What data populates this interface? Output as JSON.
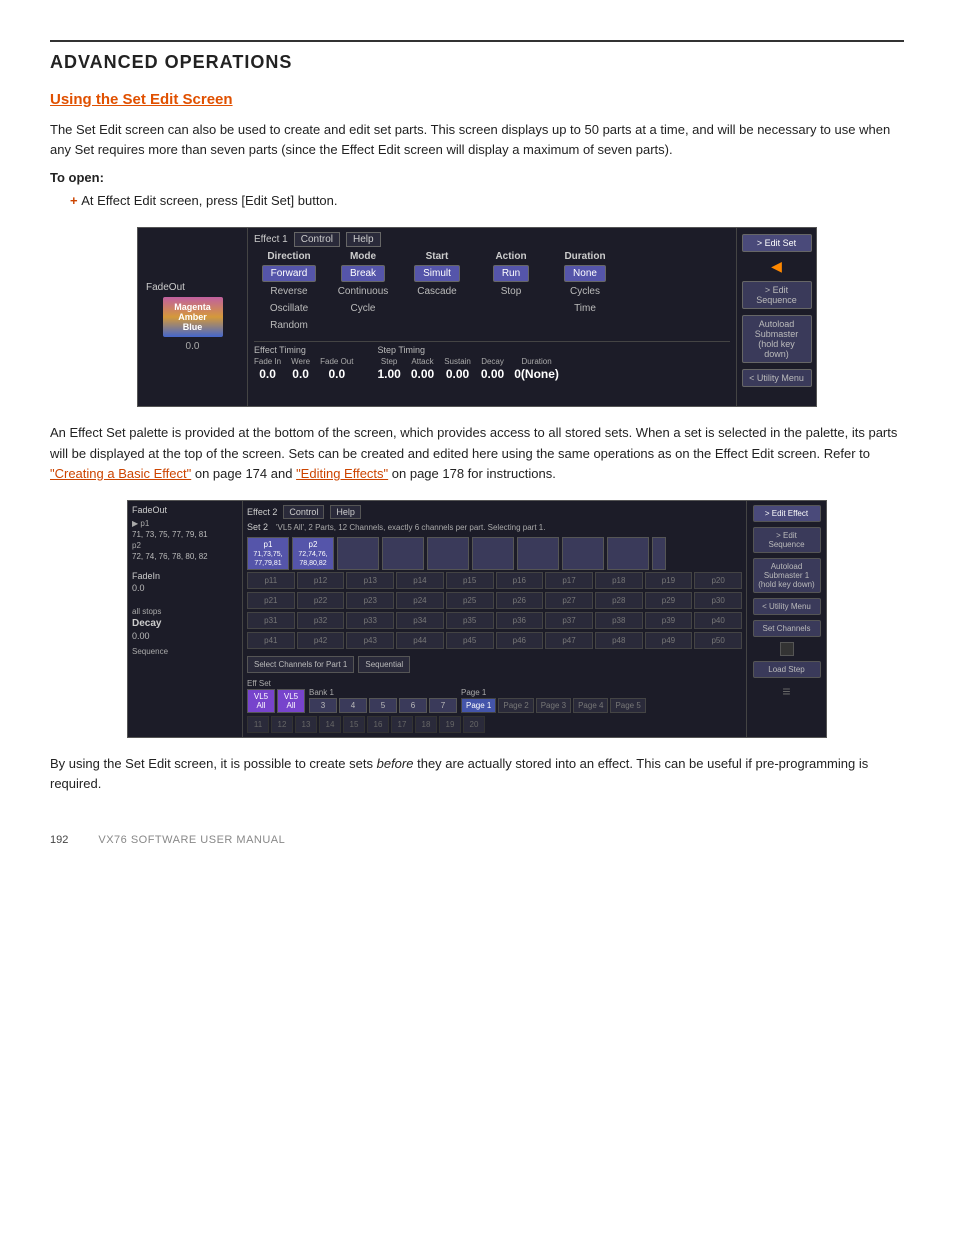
{
  "page": {
    "title": "ADVANCED OPERATIONS",
    "section_title": "Using the Set Edit Screen",
    "body_text_1": "The Set Edit screen can also be used to create and edit set parts. This screen displays up to 50 parts at a time, and will be necessary to use when any Set requires more than seven parts (since the Effect Edit screen will display a maximum of seven parts).",
    "to_open_label": "To open:",
    "bullet_1": "At Effect Edit screen, press [Edit Set] button.",
    "body_text_2_pre": "An Effect Set palette is provided at the bottom of the screen, which provides access to all stored sets. When a set is selected in the palette, its parts will be displayed at the top of the screen. Sets can be created and edited here using the same operations as on the Effect Edit screen. Refer to ",
    "link_1": "\"Creating a Basic Effect\"",
    "body_text_2_mid": " on page 174 and ",
    "link_2": "\"Editing Effects\"",
    "body_text_2_end": " on page 178 for instructions.",
    "body_text_3_pre": "By using the Set Edit screen, it is possible to create sets ",
    "body_text_3_italic": "before",
    "body_text_3_end": " they are actually stored into an effect. This can be useful if pre-programming is required.",
    "footer_page": "192",
    "footer_manual": "VX76 SOFTWARE USER MANUAL"
  },
  "screenshot1": {
    "effect_label": "Effect 1",
    "menu_control": "Control",
    "menu_help": "Help",
    "col_headers": [
      "Direction",
      "Mode",
      "Start",
      "Action",
      "Duration"
    ],
    "row1": [
      "Forward",
      "Break",
      "Simult",
      "Run",
      "None"
    ],
    "row2": [
      "Reverse",
      "Continuous",
      "Cascade",
      "Stop",
      "Cycles"
    ],
    "row3": [
      "Oscillate",
      "Cycle",
      "",
      "",
      "Time"
    ],
    "row4": [
      "Random",
      "",
      "",
      "",
      ""
    ],
    "fadeout_label": "FadeOut",
    "fadeout_val": "0.0",
    "color_lines": [
      "Magenta",
      "Amber",
      "Blue"
    ],
    "effect_timing_label": "Effect Timing",
    "step_timing_label": "Step Timing",
    "timing_headers": [
      "Fade In",
      "Were",
      "Fade Out",
      "Step",
      "Attack",
      "Sustain",
      "Decay",
      "Duration"
    ],
    "timing_vals": [
      "0.0",
      "0.0",
      "0.0",
      "1.00",
      "0.00",
      "0.00",
      "0.00",
      "0(None)"
    ],
    "side_btn1": "> Edit Set",
    "side_btn2": "> Edit Sequence",
    "side_btn3": "Autoload Submaster (hold key down)",
    "side_btn4": "< Utility Menu"
  },
  "screenshot2": {
    "effect_label": "Effect 2",
    "menu_control": "Control",
    "menu_help": "Help",
    "set_label": "Set 2",
    "info_text": "'VL5 All', 2 Parts, 12 Channels, exactly 6 channels per part.  Selecting part 1.",
    "p1_label": "p1",
    "p1_vals": "71, 73, 75, 77, 79, 81",
    "p2_label": "p2",
    "p2_vals": "72, 74, 76, 78, 80, 82",
    "fadeout_label": "FadeOut",
    "fadein_label": "FadeIn",
    "fadein_val": "0.0",
    "all_steps": "all stops",
    "decay_label": "Decay",
    "decay_val": "0.00",
    "seq_label": "Sequence",
    "part_rows": [
      [
        "p11",
        "p12",
        "p13",
        "p14",
        "p15",
        "p16",
        "p17",
        "p18",
        "p19",
        "p20"
      ],
      [
        "p21",
        "p22",
        "p23",
        "p24",
        "p25",
        "p26",
        "p27",
        "p28",
        "p29",
        "p30"
      ],
      [
        "p31",
        "p32",
        "p33",
        "p34",
        "p35",
        "p36",
        "p37",
        "p38",
        "p39",
        "p40"
      ],
      [
        "p41",
        "p42",
        "p43",
        "p44",
        "p45",
        "p46",
        "p47",
        "p48",
        "p49",
        "p50"
      ]
    ],
    "eff_set_label": "Eff Set",
    "bank_label": "Bank 1",
    "page_label": "Page 1",
    "pages": [
      "Page 1",
      "Page 2",
      "Page 3",
      "Page 4",
      "Page 5"
    ],
    "bank_items": [
      "VL5 All",
      "VL5 All",
      "3",
      "4",
      "5",
      "6",
      "7"
    ],
    "eff_nums_row1": [
      "11",
      "12",
      "13",
      "14",
      "15",
      "16",
      "17",
      "18",
      "19",
      "20"
    ],
    "select_label": "Select Channels for Part 1",
    "sequential_label": "Sequential",
    "side_btn1": "> Edit Effect",
    "side_btn2": "> Edit Sequence",
    "side_btn3": "Autoload Submaster 1 (hold key down)",
    "side_btn4": "< Utility Menu",
    "side_btn5": "Set Channels",
    "side_btn6": "Load Step"
  }
}
